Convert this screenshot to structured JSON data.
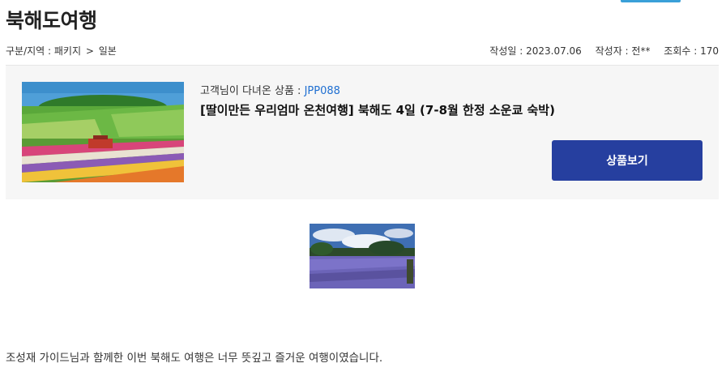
{
  "page": {
    "title": "북해도여행"
  },
  "breadcrumb": {
    "label": "구분/지역 : 패키지",
    "separator": ">",
    "region": "일본"
  },
  "post_meta": {
    "date": "작성일 : 2023.07.06",
    "author": "작성자 : 전**",
    "views": "조회수 : 170"
  },
  "product": {
    "code_prefix": "고객님이 다녀온 상품 : ",
    "code": "JPP088",
    "name": "[딸이만든 우리엄마 온천여행] 북해도 4일 (7-8월 한정 소운쿄 숙박)",
    "button_label": "상품보기"
  },
  "content": {
    "paragraph": "조성재 가이드님과 함께한 이번 북해도 여행은 너무 뜻깊고 즐거운 여행이였습니다."
  },
  "colors": {
    "button_bg": "#263f9f",
    "code_text": "#1f6fd1",
    "card_bg": "#f6f6f6"
  }
}
